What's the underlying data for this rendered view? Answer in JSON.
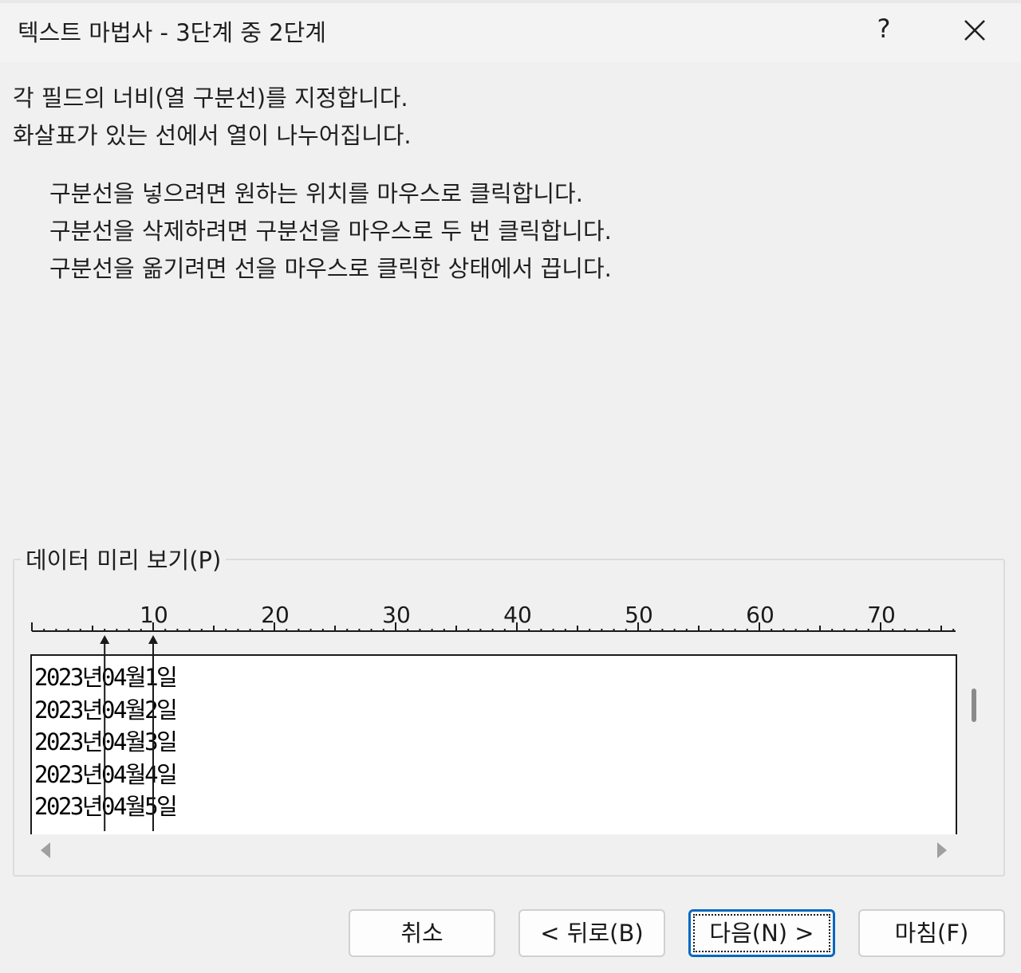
{
  "window": {
    "title": "텍스트 마법사 - 3단계 중 2단계",
    "help_label": "?",
    "close_icon": "close-icon"
  },
  "instructions": {
    "line1": "각 필드의 너비(열 구분선)를 지정합니다.",
    "line2": "화살표가 있는 선에서 열이 나누어집니다.",
    "bullet1": "구분선을 넣으려면 원하는 위치를 마우스로 클릭합니다.",
    "bullet2": "구분선을 삭제하려면 구분선을 마우스로 두 번 클릭합니다.",
    "bullet3": "구분선을 옮기려면 선을 마우스로 클릭한 상태에서 끕니다."
  },
  "preview": {
    "group_label": "데이터 미리 보기(P)",
    "ruler_labels": [
      "10",
      "20",
      "30",
      "40",
      "50",
      "60",
      "70"
    ],
    "column_breaks": [
      6,
      10
    ],
    "rows": [
      "2023년04월1일",
      "2023년04월2일",
      "2023년04월3일",
      "2023년04월4일",
      "2023년04월5일"
    ]
  },
  "buttons": {
    "cancel": "취소",
    "back": "< 뒤로(B)",
    "next": "다음(N) >",
    "finish": "마침(F)"
  },
  "colors": {
    "background": "#f0f0f0",
    "accent": "#0067c0"
  }
}
